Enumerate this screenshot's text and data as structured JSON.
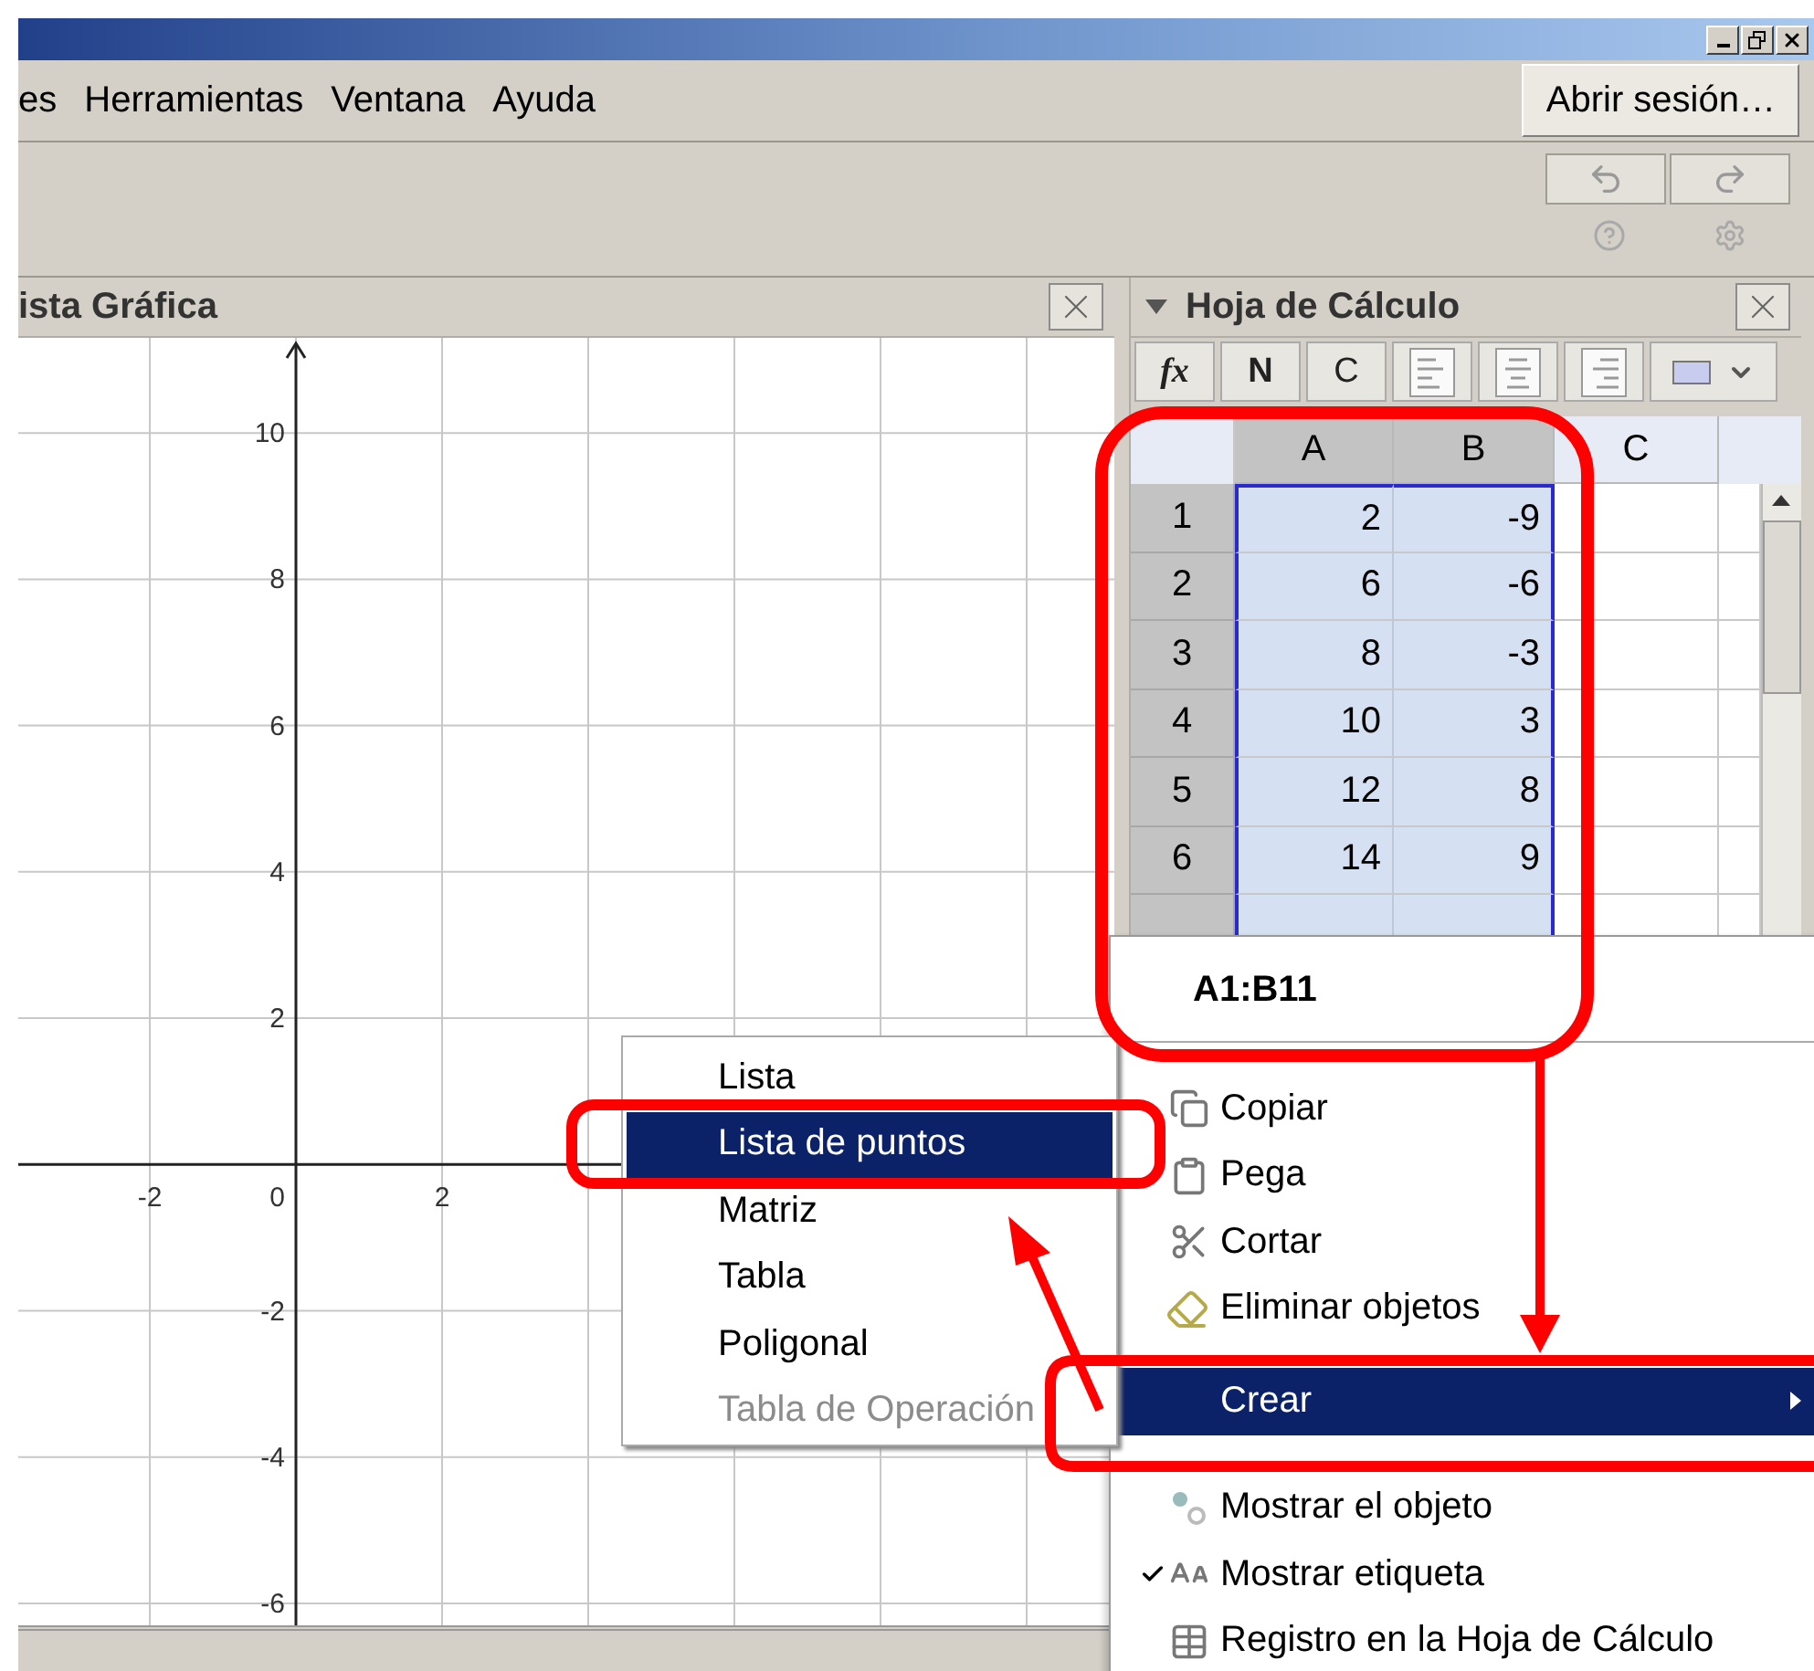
{
  "menu_bar": {
    "items": [
      "es",
      "Herramientas",
      "Ventana",
      "Ayuda"
    ],
    "sign_in": "Abrir sesión…"
  },
  "graphics_view": {
    "title": "ista Gráfica",
    "origin_label": "0",
    "chart_data": {
      "type": "scatter",
      "grid": true,
      "xlim": [
        -3.8,
        11.2
      ],
      "ylim": [
        -6.3,
        11.3
      ],
      "xticks": [
        -2,
        2
      ],
      "yticks": [
        -6,
        -4,
        -2,
        2,
        4,
        6,
        8,
        10
      ]
    }
  },
  "spreadsheet": {
    "title": "Hoja de Cálculo",
    "toolbar": [
      {
        "kind": "formula",
        "label": "fx"
      },
      {
        "kind": "bold",
        "label": "N"
      },
      {
        "kind": "italic",
        "label": "C"
      },
      {
        "kind": "align-left"
      },
      {
        "kind": "align-center"
      },
      {
        "kind": "align-right"
      },
      {
        "kind": "color"
      }
    ],
    "columns": [
      {
        "label": "A",
        "selected": true
      },
      {
        "label": "B",
        "selected": true
      },
      {
        "label": "C",
        "selected": false
      }
    ],
    "rows": [
      {
        "label": "1",
        "selected": true,
        "cells": [
          {
            "value": "2",
            "selected": true
          },
          {
            "value": "-9",
            "selected": true
          }
        ]
      },
      {
        "label": "2",
        "selected": true,
        "cells": [
          {
            "value": "6",
            "selected": true
          },
          {
            "value": "-6",
            "selected": true
          }
        ]
      },
      {
        "label": "3",
        "selected": true,
        "cells": [
          {
            "value": "8",
            "selected": true
          },
          {
            "value": "-3",
            "selected": true
          }
        ]
      },
      {
        "label": "4",
        "selected": true,
        "cells": [
          {
            "value": "10",
            "selected": true
          },
          {
            "value": "3",
            "selected": true
          }
        ]
      },
      {
        "label": "5",
        "selected": true,
        "cells": [
          {
            "value": "12",
            "selected": true
          },
          {
            "value": "8",
            "selected": true
          }
        ]
      },
      {
        "label": "6",
        "selected": true,
        "cells": [
          {
            "value": "14",
            "selected": true
          },
          {
            "value": "9",
            "selected": true
          }
        ]
      }
    ]
  },
  "context_menu": {
    "title": "A1:B11",
    "items": [
      {
        "kind": "copy",
        "label": "Copiar",
        "selected": false
      },
      {
        "kind": "paste",
        "label": "Pega",
        "selected": false
      },
      {
        "kind": "cut",
        "label": "Cortar",
        "selected": false
      },
      {
        "kind": "erase",
        "label": "Eliminar objetos",
        "selected": false
      },
      {
        "kind": "create",
        "label": "Crear",
        "selected": true
      },
      {
        "kind": "show",
        "label": "Mostrar el objeto",
        "selected": false,
        "checked": false
      },
      {
        "kind": "label",
        "label": "Mostrar etiqueta",
        "selected": false,
        "checked": true
      },
      {
        "kind": "record",
        "label": "Registro en la Hoja de Cálculo",
        "selected": false
      }
    ]
  },
  "submenu": {
    "items": [
      {
        "label": "Lista",
        "selected": false,
        "disabled": false
      },
      {
        "label": "Lista de puntos",
        "selected": true,
        "disabled": false
      },
      {
        "label": "Matriz",
        "selected": false,
        "disabled": false
      },
      {
        "label": "Tabla",
        "selected": false,
        "disabled": false
      },
      {
        "label": "Poligonal",
        "selected": false,
        "disabled": false
      },
      {
        "label": "Tabla de Operación",
        "selected": false,
        "disabled": true
      }
    ]
  }
}
